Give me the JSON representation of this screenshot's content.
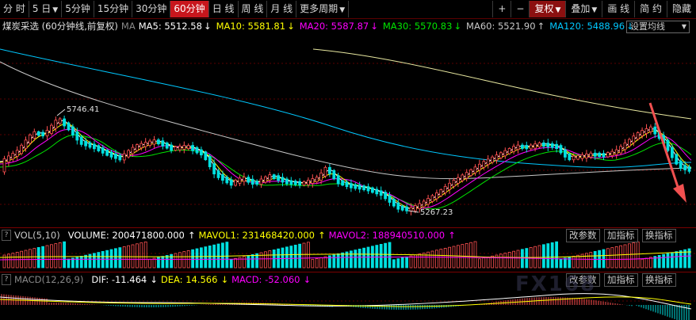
{
  "toolbar": {
    "tabs": [
      {
        "label": "分 时",
        "dropdown": false,
        "active": false
      },
      {
        "label": "5 日",
        "dropdown": true,
        "active": false
      },
      {
        "label": "5分钟",
        "dropdown": false,
        "active": false
      },
      {
        "label": "15分钟",
        "dropdown": false,
        "active": false
      },
      {
        "label": "30分钟",
        "dropdown": false,
        "active": false
      },
      {
        "label": "60分钟",
        "dropdown": false,
        "active": true
      },
      {
        "label": "日 线",
        "dropdown": false,
        "active": false
      },
      {
        "label": "周 线",
        "dropdown": false,
        "active": false
      },
      {
        "label": "月 线",
        "dropdown": false,
        "active": false
      },
      {
        "label": "更多周期",
        "dropdown": true,
        "active": false
      }
    ],
    "zoom_in": "+",
    "zoom_out": "−",
    "restore_label": "复权",
    "overlay_label": "叠加",
    "draw_label": "画 线",
    "brief_label": "简 约",
    "hide_label": "隐藏"
  },
  "price_panel": {
    "title": "煤炭采选 (60分钟线,前复权)",
    "ma_label": "MA",
    "ma": [
      {
        "label": "MA5: 5512.58",
        "arrow": "↓",
        "color": "#ffffff"
      },
      {
        "label": "MA10: 5581.81",
        "arrow": "↓",
        "color": "#ffff00"
      },
      {
        "label": "MA20: 5587.87",
        "arrow": "↓",
        "color": "#ff00ff"
      },
      {
        "label": "MA30: 5570.83",
        "arrow": "↓",
        "color": "#00e600"
      },
      {
        "label": "MA60: 5521.90",
        "arrow": "↑",
        "color": "#c8c8c8"
      },
      {
        "label": "MA120: 5488.96",
        "arrow": "↓",
        "color": "#00c8ff"
      }
    ],
    "settings_label": "设置均线",
    "high_label": "5746.41",
    "low_label": "5267.23"
  },
  "volume_panel": {
    "title": "VOL(5,10)",
    "volume": "VOLUME: 200471800.000",
    "volume_arrow": "↑",
    "mavol1": "MAVOL1: 231468420.000",
    "mavol1_arrow": "↑",
    "mavol2": "MAVOL2: 188940510.000",
    "mavol2_arrow": "↑",
    "btn_params": "改参数",
    "btn_add": "加指标",
    "btn_switch": "换指标"
  },
  "macd_panel": {
    "title": "MACD(12,26,9)",
    "dif": "DIF: -11.464",
    "dif_arrow": "↓",
    "dea": "DEA: 14.566",
    "dea_arrow": "↓",
    "macd": "MACD: -52.060",
    "macd_arrow": "↓",
    "btn_params": "改参数",
    "btn_add": "加指标",
    "btn_switch": "换指标"
  },
  "colors": {
    "up": "#ff5050",
    "down": "#00e0e0",
    "accent": "#c8161d"
  },
  "watermark": "FX168"
}
